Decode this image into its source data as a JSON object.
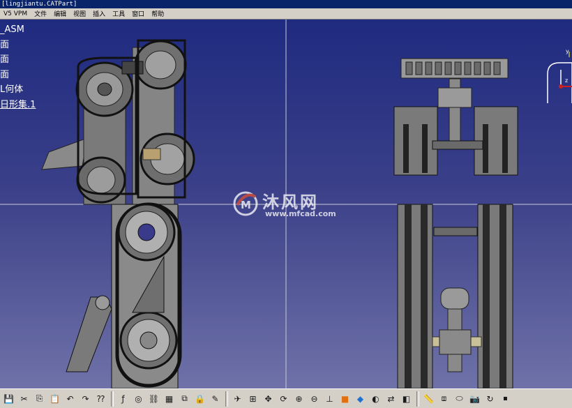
{
  "window": {
    "title": "[lingjiantu.CATPart]"
  },
  "menubar": {
    "items": [
      "V5 VPM",
      "文件",
      "编辑",
      "视图",
      "插入",
      "工具",
      "窗口",
      "帮助"
    ]
  },
  "tree": {
    "items": [
      "_ASM",
      "面",
      "面",
      "面",
      "L何体",
      "日形集.1"
    ]
  },
  "watermark": {
    "brand": "沐风网",
    "url": "www.mfcad.com"
  },
  "compass": {
    "y_label": "y",
    "z_label": "z"
  },
  "toolbar": {
    "icons": [
      "save-icon",
      "cut-icon",
      "copy-icon",
      "paste-icon",
      "undo-icon",
      "redo-icon",
      "whats-this-icon",
      "formula-icon",
      "knowledge-icon",
      "chain-icon",
      "table-icon",
      "hierarchy-icon",
      "lock-icon",
      "sketch-icon",
      "fly-icon",
      "fit-all-icon",
      "pan-icon",
      "rotate-icon",
      "zoom-in-icon",
      "zoom-out-icon",
      "normal-view-icon",
      "shading-icon",
      "iso-view-icon",
      "hide-show-icon",
      "swap-visible-icon",
      "render-icon",
      "measure-icon",
      "catalog-icon",
      "material-icon",
      "capture-icon",
      "update-icon",
      "stop-icon"
    ]
  },
  "colors": {
    "background_top": "#1f2b80",
    "background_bottom": "#6f72a8",
    "panel_gray": "#d4d0c8",
    "title_blue": "#0a246a"
  }
}
